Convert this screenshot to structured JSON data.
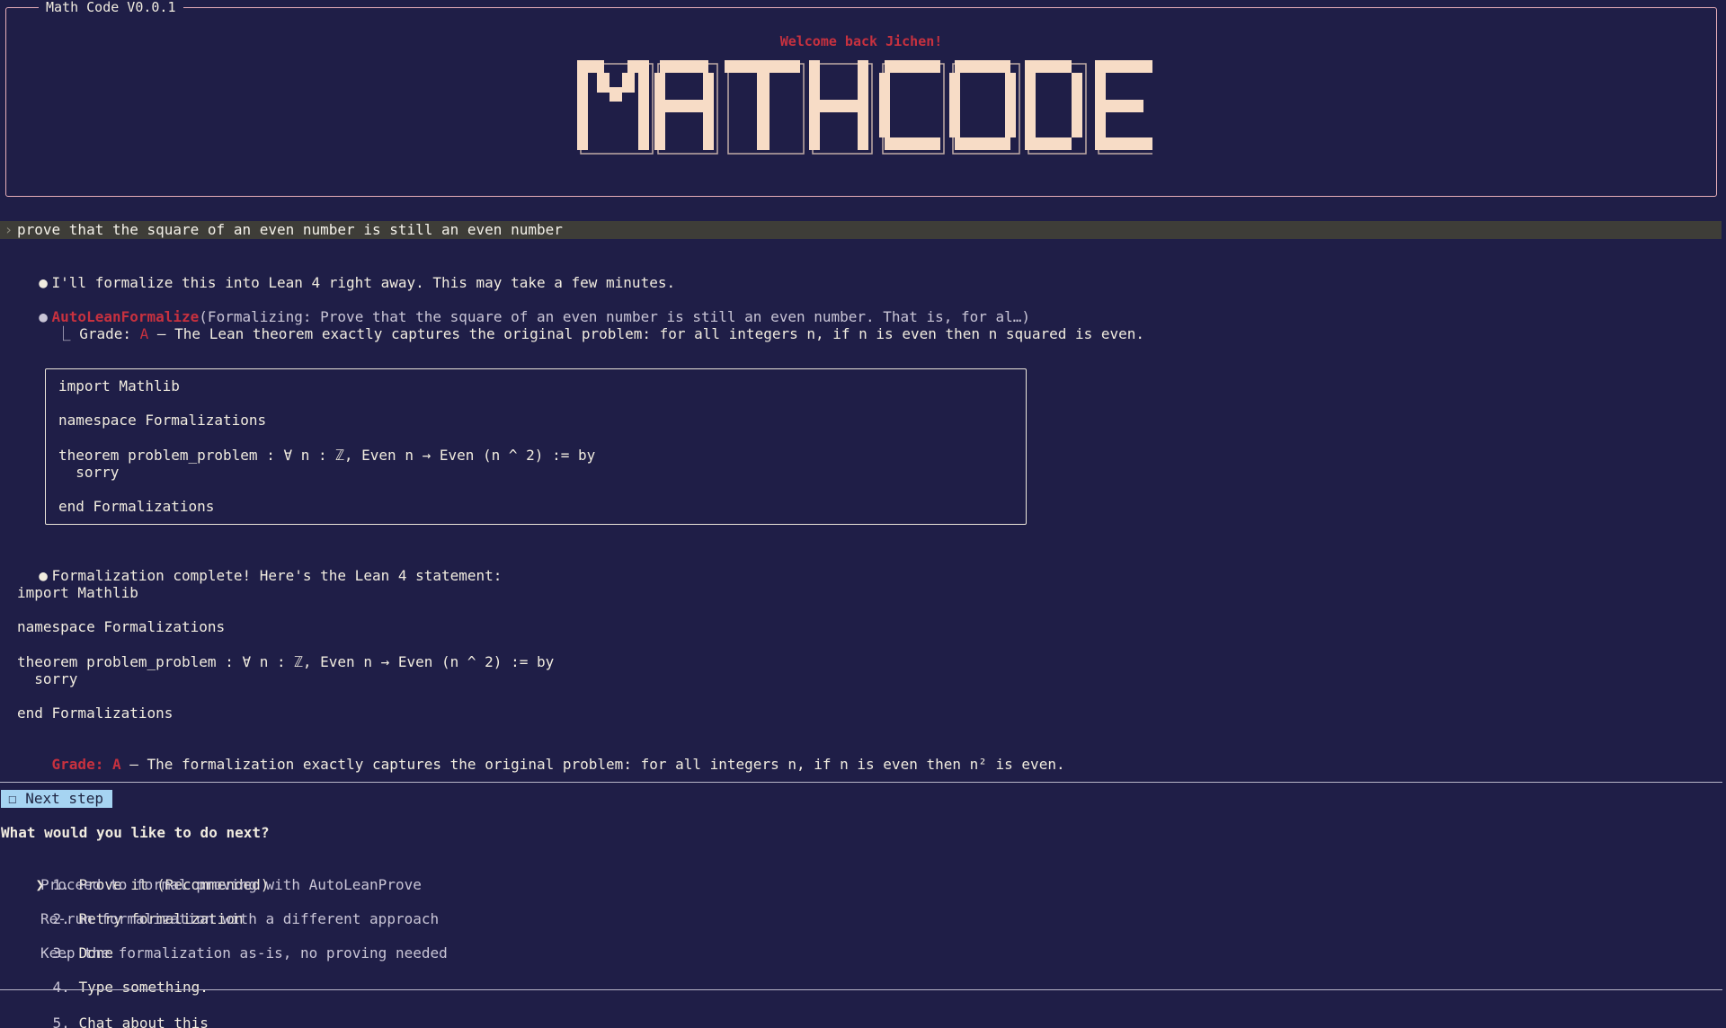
{
  "header": {
    "title": "Math Code V0.0.1",
    "welcome": "Welcome back Jichen!",
    "logo_text": "MATHCODE"
  },
  "prompt": {
    "caret": "›",
    "text": "prove that the square of an even number is still an even number"
  },
  "messages": {
    "intro": {
      "bullet": "●",
      "text": "I'll formalize this into Lean 4 right away. This may take a few minutes."
    },
    "tool_call": {
      "bullet": "●",
      "name": "AutoLeanFormalize",
      "args": "(Formalizing: Prove that the square of an even number is still an even number. That is, for al…)",
      "result_connector": "⎿",
      "grade_label": "Grade:",
      "grade_value": "A",
      "grade_text": " – The Lean theorem exactly captures the original problem: for all integers n, if n is even then n squared is even."
    },
    "code_block": [
      "import Mathlib",
      "",
      "namespace Formalizations",
      "",
      "theorem problem_problem : ∀ n : ℤ, Even n → Even (n ^ 2) := by",
      "  sorry",
      "",
      "end Formalizations"
    ],
    "complete": {
      "bullet": "●",
      "text": "Formalization complete! Here's the Lean 4 statement:",
      "code": [
        "import Mathlib",
        "",
        "namespace Formalizations",
        "",
        "theorem problem_problem : ∀ n : ℤ, Even n → Even (n ^ 2) := by",
        "  sorry",
        "",
        "end Formalizations"
      ],
      "grade_label": "Grade:",
      "grade_value": "A",
      "grade_text": " – The formalization exactly captures the original problem: for all integers n, if n is even then n² is even."
    }
  },
  "next_step": {
    "tab_label": "☐ Next step",
    "question": "What would you like to do next?",
    "selected_caret": "❯",
    "options": [
      {
        "num": "1.",
        "label": "Prove it (Recommended)",
        "desc": "Proceed to formal proving with AutoLeanProve"
      },
      {
        "num": "2.",
        "label": "Retry formalization",
        "desc": "Re-run formalization with a different approach"
      },
      {
        "num": "3.",
        "label": "Done",
        "desc": "Keep the formalization as-is, no proving needed"
      },
      {
        "num": "4.",
        "label": "Type something.",
        "desc": ""
      }
    ],
    "chat_option": {
      "num": "5.",
      "label": "Chat about this"
    }
  },
  "colors": {
    "background": "#1f1e47",
    "accent_red": "#c7313f",
    "header_border": "#e7aeb8",
    "logo_fill": "#f7dcc6",
    "badge_bg": "#a6d4f2"
  }
}
